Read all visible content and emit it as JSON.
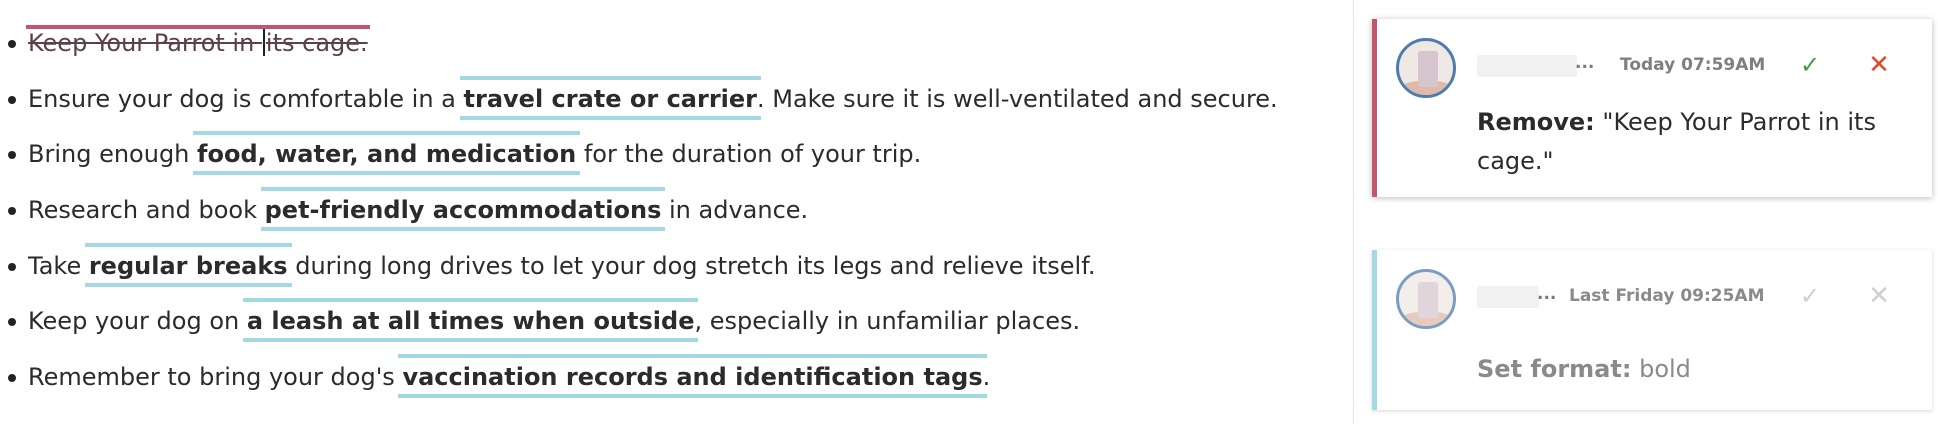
{
  "document": {
    "items": [
      {
        "pre": "",
        "bold": "",
        "post": "",
        "deleted_a": "Keep Your Parrot in ",
        "deleted_b": "its cage."
      },
      {
        "pre": "Ensure your dog is comfortable in a ",
        "bold": "travel crate or carrier",
        "post": ". Make sure it is well-ventilated and secure."
      },
      {
        "pre": "Bring enough ",
        "bold": "food, water, and medication",
        "post": " for the duration of your trip."
      },
      {
        "pre": "Research and book ",
        "bold": "pet-friendly accommodations",
        "post": " in advance."
      },
      {
        "pre": "Take ",
        "bold": "regular breaks",
        "post": " during long drives to let your dog stretch its legs and relieve itself."
      },
      {
        "pre": "Keep your dog on ",
        "bold": "a leash at all times when outside",
        "post": ", especially in unfamiliar places."
      },
      {
        "pre": "Remember to bring your dog's ",
        "bold": "vaccination records and identification tags",
        "post": "."
      }
    ]
  },
  "comments": [
    {
      "author_ellipsis": "...",
      "timestamp": "Today 07:59AM",
      "accept_icon": "check-icon",
      "reject_icon": "close-icon",
      "action_label": "Remove:",
      "action_value": "\"Keep Your Parrot in its cage.\"",
      "accent": "#c3566e"
    },
    {
      "author_ellipsis": "...",
      "timestamp": "Last Friday 09:25AM",
      "accept_icon": "check-icon",
      "reject_icon": "close-icon",
      "action_label": "Set format:",
      "action_value": "bold",
      "accent": "#a3d9e2"
    }
  ],
  "colors": {
    "deletion_highlight": "#ef9aae",
    "format_underline": "#a3d9e2",
    "accept_green": "#3e9d4a",
    "reject_red": "#e04a2c"
  }
}
